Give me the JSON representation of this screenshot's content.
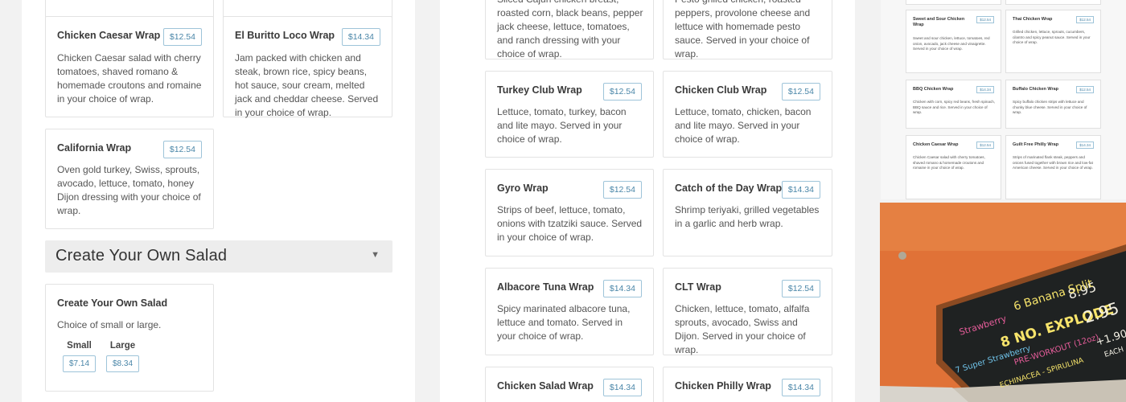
{
  "left": {
    "cards": [
      {
        "name": "Chicken Caesar Wrap",
        "price": "$12.54",
        "desc": "Chicken Caesar salad with cherry tomatoes, shaved romano & homemade croutons and romaine in your choice of wrap."
      },
      {
        "name": "El Buritto Loco Wrap",
        "price": "$14.34",
        "desc": "Jam packed with chicken and steak, brown rice, spicy beans, hot sauce, sour cream, melted jack and cheddar cheese. Served in your choice of wrap."
      },
      {
        "name": "California Wrap",
        "price": "$12.54",
        "desc": "Oven gold turkey, Swiss, sprouts, avocado, lettuce, tomato, honey Dijon dressing with your choice of wrap."
      }
    ],
    "section_title": "Create Your Own Salad",
    "salad": {
      "name": "Create Your Own Salad",
      "desc": "Choice of small or large.",
      "sizes": [
        {
          "label": "Small",
          "price": "$7.14"
        },
        {
          "label": "Large",
          "price": "$8.34"
        }
      ]
    }
  },
  "middle": {
    "top_cards": [
      {
        "desc": "Sliced Cajun chicken breast, roasted corn, black beans, pepper jack cheese, lettuce, tomatoes, and ranch dressing with your choice of wrap."
      },
      {
        "desc": "Pesto grilled chicken, roasted peppers, provolone cheese and lettuce with homemade pesto sauce. Served in your choice of wrap."
      }
    ],
    "cards": [
      {
        "name": "Turkey Club Wrap",
        "price": "$12.54",
        "desc": "Lettuce, tomato, turkey, bacon and lite mayo. Served in your choice of wrap."
      },
      {
        "name": "Chicken Club Wrap",
        "price": "$12.54",
        "desc": "Lettuce, tomato, chicken, bacon and lite mayo. Served in your choice of wrap."
      },
      {
        "name": "Gyro Wrap",
        "price": "$12.54",
        "desc": "Strips of beef, lettuce, tomato, onions with tzatziki sauce. Served in your choice of wrap."
      },
      {
        "name": "Catch of the Day Wrap",
        "price": "$14.34",
        "desc": "Shrimp teriyaki, grilled vegetables in a garlic and herb wrap."
      },
      {
        "name": "Albacore Tuna Wrap",
        "price": "$14.34",
        "desc": "Spicy marinated albacore tuna, lettuce and tomato. Served in your choice of wrap."
      },
      {
        "name": "CLT Wrap",
        "price": "$12.54",
        "desc": "Chicken, lettuce, tomato, alfalfa sprouts, avocado, Swiss and Dijon. Served in your choice of wrap."
      },
      {
        "name": "Chicken Salad Wrap",
        "price": "$14.34",
        "desc": ""
      },
      {
        "name": "Chicken Philly Wrap",
        "price": "$14.34",
        "desc": ""
      }
    ]
  },
  "thumb": {
    "cards": [
      {
        "name": "Sweet and Sour Chicken Wrap",
        "price": "$12.54",
        "desc": "Sweet and sour chicken, lettuce, tomatoes, red onion, avocado, jack cheese and vinaigrette. Served in your choice of wrap."
      },
      {
        "name": "Thai Chicken Wrap",
        "price": "$12.54",
        "desc": "Grilled chicken, lettuce, sprouts, cucumbers, cilantro and spicy peanut sauce. Served in your choice of wrap."
      },
      {
        "name": "BBQ Chicken Wrap",
        "price": "$14.34",
        "desc": "Chicken with corn, spicy red beans, fresh spinach, BBQ sauce and rice. Served in your choice of wrap."
      },
      {
        "name": "Buffalo Chicken Wrap",
        "price": "$12.54",
        "desc": "Spicy buffalo chicken strips with lettuce and chunky blue cheese. Served in your choice of wrap."
      },
      {
        "name": "Chicken Caesar Wrap",
        "price": "$12.54",
        "desc": "Chicken Caesar salad with cherry tomatoes, shaved romano & homemade croutons and romaine in your choice of wrap."
      },
      {
        "name": "Guilt Free Philly Wrap",
        "price": "$14.34",
        "desc": "Strips of marinated flank steak, peppers and onions fused together with brown rice and low-fat American cheese. Served in your choice of wrap."
      }
    ]
  },
  "photo": {
    "board_lines": [
      "8.95",
      "6 Banana Split",
      "Strawberry",
      "8 NO. EXPLODE",
      "2.95",
      "PRE-WORKOUT (12oz)",
      "7 Super Strawberry",
      "ECHINACEA - SPIRULINA",
      "+1.90",
      "EACH"
    ]
  },
  "colors": {
    "accent": "#4a86a8",
    "photo_wall": "#e0743a",
    "board": "#1f2222"
  }
}
